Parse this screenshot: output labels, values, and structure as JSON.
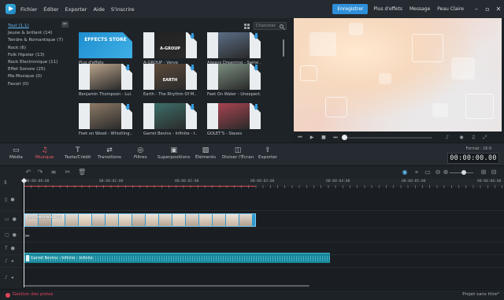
{
  "app": {
    "menu": [
      "Fichier",
      "Éditer",
      "Exporter",
      "Aide",
      "S'inscrire"
    ],
    "register_label": "Enregistrer",
    "links": [
      "Plus d'effets",
      "Message",
      "Peau Claire"
    ]
  },
  "categories": {
    "items": [
      "Tout (1.1)",
      "Jeune & brillant (14)",
      "Tendre & Romantique (7)",
      "Rock (6)",
      "Folk Hipster (13)",
      "Rock Electronique (11)",
      "Effet Sonore (25)",
      "Ma Musique (0)",
      "Favori (0)"
    ],
    "active_index": 0
  },
  "media": {
    "search_placeholder": "Chercher",
    "tiles": [
      {
        "label": "Plus d'effets",
        "cover_text": "EFFECTS STORE",
        "color": "#1f8ed0"
      },
      {
        "label": "A-GROUP - Verve",
        "cover_text": "A-GROUP",
        "color": "#222"
      },
      {
        "label": "Always Dreaming - Same ...",
        "cover_text": "",
        "color": "#5b6e86"
      },
      {
        "label": "Benjamin Thompson - Lul...",
        "cover_text": "",
        "color": "#b9a38a"
      },
      {
        "label": "Earth - The Rhythm Of M...",
        "cover_text": "EARTH",
        "color": "#5c4a3a"
      },
      {
        "label": "Feet On Water - Unexpect...",
        "cover_text": "",
        "color": "#7a8d7f"
      },
      {
        "label": "Feet on Wood - Whistling...",
        "cover_text": "",
        "color": "#8d7a66"
      },
      {
        "label": "Garret Bevins - Infinite - I...",
        "cover_text": "",
        "color": "#3d6f6a"
      },
      {
        "label": "GOLET'S - Slaves",
        "cover_text": "",
        "color": "#a84450"
      }
    ]
  },
  "toolbar": {
    "tools": [
      "Média",
      "Musique",
      "Texte/Crédit",
      "Transitions",
      "Filtres",
      "Superpositions",
      "Éléments",
      "Diviser l'Écran",
      "Exporter"
    ],
    "active_index": 1,
    "format_label": "Format : 16:9",
    "timecode": "00:00:00.00"
  },
  "ruler": {
    "ticks": [
      "00:00:00:00",
      "00:00:01:00",
      "00:00:02:00",
      "00:00:03:00",
      "00:00:04:00",
      "00:00:05:00",
      "00:00:06:00"
    ]
  },
  "timeline": {
    "video_clip_title": "phoneniebaby",
    "audio_clip_label": "Garret Bevins - Infinite - Infinite"
  },
  "status": {
    "left": "Gestion des pistes",
    "right": "Projet sans titre*"
  },
  "colors": {
    "accent": "#2f8fd8",
    "active_tool": "#f05a6b",
    "video_clip": "#2f9ad0",
    "audio_clip": "#19879a"
  }
}
